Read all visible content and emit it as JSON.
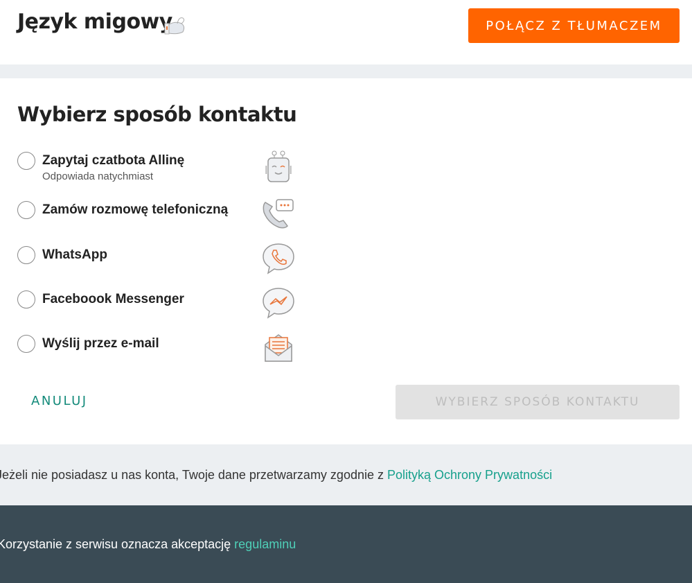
{
  "header": {
    "title": "Język migowy",
    "title_icon": "sign-language-hand-icon",
    "connect_button": "POŁĄCZ Z TŁUMACZEM"
  },
  "colors": {
    "accent": "#ff6400",
    "link": "#16a08c",
    "footer_bg": "#3a4b55"
  },
  "contact": {
    "heading": "Wybierz sposób kontaktu",
    "options": [
      {
        "label": "Zapytaj czatbota Allinę",
        "sub": "Odpowiada natychmiast",
        "icon": "chatbot-robot-icon"
      },
      {
        "label": "Zamów rozmowę telefoniczną",
        "icon": "phone-callback-icon"
      },
      {
        "label": "WhatsApp",
        "icon": "whatsapp-icon"
      },
      {
        "label": "Faceboook Messenger",
        "icon": "messenger-icon"
      },
      {
        "label": "Wyślij przez e-mail",
        "icon": "email-icon"
      }
    ],
    "cancel": "ANULUJ",
    "submit": "WYBIERZ SPOSÓB KONTAKTU"
  },
  "privacy": {
    "text": "Jeżeli nie posiadasz u nas konta, Twoje dane przetwarzamy zgodnie z ",
    "link": "Polityką Ochrony Prywatności"
  },
  "footer": {
    "text": "Korzystanie z serwisu oznacza akceptację ",
    "link": "regulaminu"
  }
}
